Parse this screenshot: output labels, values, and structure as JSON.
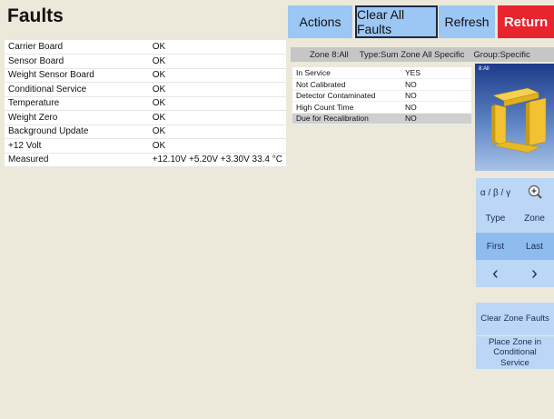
{
  "header": {
    "title": "Faults",
    "actions_label": "Actions",
    "clear_all_label": "Clear All Faults",
    "refresh_label": "Refresh",
    "return_label": "Return"
  },
  "status_rows": [
    {
      "name": "Carrier Board",
      "value": "OK"
    },
    {
      "name": "Sensor Board",
      "value": "OK"
    },
    {
      "name": "Weight Sensor Board",
      "value": "OK"
    },
    {
      "name": "Conditional Service",
      "value": "OK"
    },
    {
      "name": "Temperature",
      "value": "OK"
    },
    {
      "name": "Weight Zero",
      "value": "OK"
    },
    {
      "name": "Background Update",
      "value": "OK"
    },
    {
      "name": "+12 Volt",
      "value": "OK"
    },
    {
      "name": "Measured",
      "value": "+12.10V +5.20V +3.30V 33.4 °C"
    }
  ],
  "zone": {
    "header_zone": "Zone 8:All",
    "header_type": "Type:Sum Zone All Specific",
    "header_group": "Group:Specific",
    "details": [
      {
        "name": "In Service",
        "value": "YES"
      },
      {
        "name": "Not Calibrated",
        "value": "NO"
      },
      {
        "name": "Detector Contaminated",
        "value": "NO"
      },
      {
        "name": "High Count Time",
        "value": "NO"
      },
      {
        "name": "Due for Recalibration",
        "value": "NO"
      }
    ],
    "viewer_label": "8:All"
  },
  "controls": {
    "angles_label": "α / β / γ",
    "zoom_icon": "zoom-in-icon",
    "type_label": "Type",
    "zone_label": "Zone",
    "first_label": "First",
    "last_label": "Last",
    "prev_glyph": "‹",
    "next_glyph": "›",
    "clear_zone_label": "Clear Zone Faults",
    "place_zone_label": "Place Zone in Conditional Service"
  },
  "colors": {
    "background": "#ece8da",
    "button_blue": "#9cc6f4",
    "return_red": "#e8242e",
    "panel_yellow": "#f0c030"
  }
}
